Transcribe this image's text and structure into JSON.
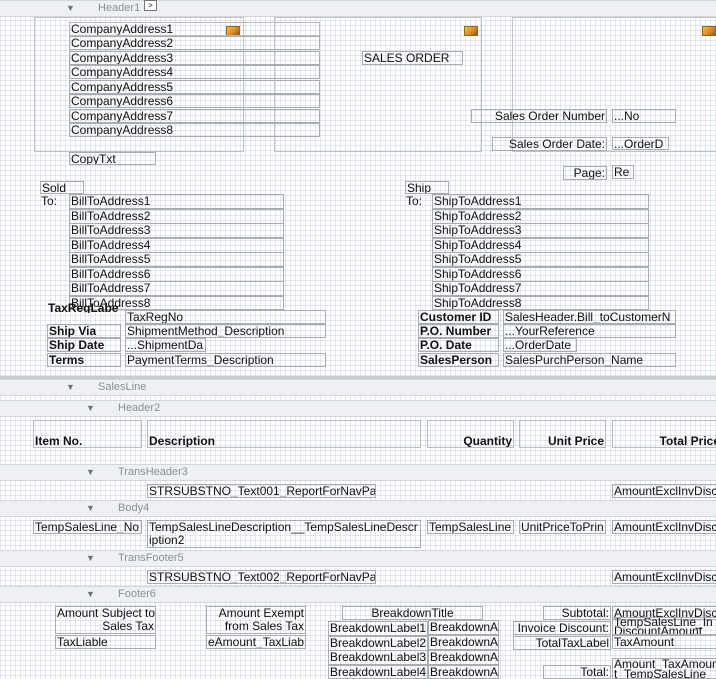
{
  "bands": {
    "header1": "Header1",
    "salesline": "SalesLine",
    "header2": "Header2",
    "transheader3": "TransHeader3",
    "body4": "Body4",
    "transfooter5": "TransFooter5",
    "footer6": "Footer6"
  },
  "header": {
    "company_address": [
      "CompanyAddress1",
      "CompanyAddress2",
      "CompanyAddress3",
      "CompanyAddress4",
      "CompanyAddress5",
      "CompanyAddress6",
      "CompanyAddress7",
      "CompanyAddress8"
    ],
    "copy_txt": "CopyTxt",
    "title": "SALES ORDER",
    "sales_order_number_label": "Sales Order Number",
    "sales_order_number_value": "...No",
    "sales_order_date_label": "Sales Order Date:",
    "sales_order_date_value": "...OrderD",
    "page_label": "Page:",
    "page_value": "Re",
    "sold_label": "Sold",
    "sold_to_label": "To:",
    "bill_to": [
      "BillToAddress1",
      "BillToAddress2",
      "BillToAddress3",
      "BillToAddress4",
      "BillToAddress5",
      "BillToAddress6",
      "BillToAddress7",
      "BillToAddress8"
    ],
    "ship_label": "Ship",
    "ship_to_label": "To:",
    "ship_to": [
      "ShipToAddress1",
      "ShipToAddress2",
      "ShipToAddress3",
      "ShipToAddress4",
      "ShipToAddress5",
      "ShipToAddress6",
      "ShipToAddress7",
      "ShipToAddress8"
    ],
    "tax_reg_label": "TaxRegLabe",
    "tax_reg_value": "TaxRegNo",
    "ship_via_label": "Ship Via",
    "ship_via_value": "ShipmentMethod_Description",
    "ship_date_label": "Ship Date",
    "ship_date_value": "...ShipmentDa",
    "terms_label": "Terms",
    "terms_value": "PaymentTerms_Description",
    "customer_id_label": "Customer ID",
    "customer_id_value": "SalesHeader.Bill_toCustomerN",
    "po_number_label": "P.O. Number",
    "po_number_value": "...YourReference",
    "po_date_label": "P.O. Date",
    "po_date_value": "...OrderDate",
    "salesperson_label": "SalesPerson",
    "salesperson_value": "SalesPurchPerson_Name"
  },
  "columns": {
    "item_no": "Item No.",
    "description": "Description",
    "quantity": "Quantity",
    "unit_price": "Unit Price",
    "total_price": "Total Price"
  },
  "transheader": {
    "text": "STRSUBSTNO_Text001_ReportForNavPa",
    "amount": "AmountExclInvDisc"
  },
  "body": {
    "no": "TempSalesLine_No",
    "description": "TempSalesLineDescription__TempSalesLineDescr",
    "description_wrap": "iption2",
    "quantity": "TempSalesLine",
    "unit_price": "UnitPriceToPrin",
    "amount": "AmountExclInvDisc"
  },
  "transfooter": {
    "text": "STRSUBSTNO_Text002_ReportForNavPa",
    "amount": "AmountExclInvDisc"
  },
  "footer": {
    "amount_subject_1": "Amount Subject to",
    "amount_subject_2": "Sales Tax",
    "tax_liable": "TaxLiable",
    "amount_exempt_1": "Amount Exempt",
    "amount_exempt_2": "from Sales Tax",
    "amount_taxliable": "eAmount_TaxLiabl",
    "breakdown_title": "BreakdownTitle",
    "breakdown_labels": [
      "BreakdownLabel1",
      "BreakdownLabel2",
      "BreakdownLabel3",
      "BreakdownLabel4"
    ],
    "breakdown_amounts": [
      "BreakdownA",
      "BreakdownA",
      "BreakdownA",
      "BreakdownA"
    ],
    "subtotal_label": "Subtotal:",
    "subtotal_value": "AmountExclInvDisc",
    "invoice_discount_label": "Invoice Discount:",
    "invoice_discount_value_1": "TempSalesLine_In",
    "invoice_discount_value_2": "DiscountAmount",
    "total_tax_label": "TotalTaxLabel",
    "tax_amount": "TaxAmount",
    "total_label": "Total:",
    "total_value_1": "Amount_TaxAmoun",
    "total_value_2": "t_TempSalesLine"
  },
  "icons": [
    "image-placeholder-icon",
    "collapse-arrow-icon",
    "expand-button-icon"
  ]
}
